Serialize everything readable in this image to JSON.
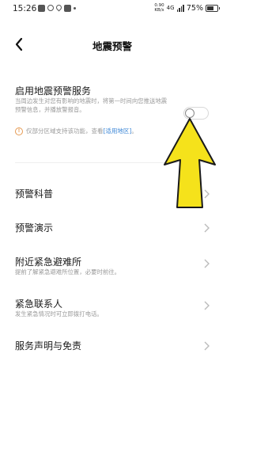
{
  "status_bar": {
    "time": "15:26",
    "net_speed_value": "0.90",
    "net_speed_unit": "KB/s",
    "network_type": "4G",
    "battery_pct": "75%",
    "battery_level": 0.75
  },
  "nav": {
    "title": "地震预警"
  },
  "service": {
    "title": "启用地震预警服务",
    "description": "当周边发生对您有影响的地震时，将第一时间向您推送地震预警信息，并播放警报音。",
    "enabled": false
  },
  "notice": {
    "text": "仅部分区域支持该功能，查看",
    "link": "[适用地区]",
    "suffix": "。"
  },
  "menu": [
    {
      "title": "预警科普",
      "subtitle": ""
    },
    {
      "title": "预警演示",
      "subtitle": ""
    },
    {
      "title": "附近紧急避难所",
      "subtitle": "提前了解紧急避难所位置，必要时前往。"
    },
    {
      "title": "紧急联系人",
      "subtitle": "发生紧急情况时可立即拨打电话。"
    },
    {
      "title": "服务声明与免责",
      "subtitle": ""
    }
  ],
  "colors": {
    "annotation_arrow": "#f5e21b",
    "link": "#3b86d6",
    "info": "#e69a52"
  }
}
